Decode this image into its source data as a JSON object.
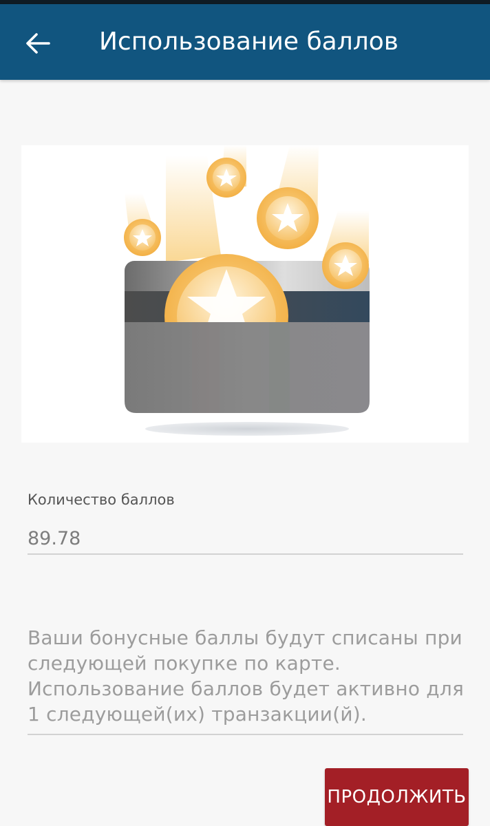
{
  "header": {
    "title": "Использование баллов",
    "back_icon": "arrow-left-icon",
    "background_color": "#11557f"
  },
  "illustration": {
    "icon": "card-with-star-coins-icon"
  },
  "points": {
    "label": "Количество баллов",
    "value": "89.78"
  },
  "info": {
    "text": "Ваши бонусные баллы будут списаны при\nследующей покупке по карте.\nИспользование баллов будет активно для\n1 следующей(их) транзакции(й)."
  },
  "actions": {
    "continue_label": "ПРОДОЛЖИТЬ",
    "continue_color": "#a31f26"
  }
}
